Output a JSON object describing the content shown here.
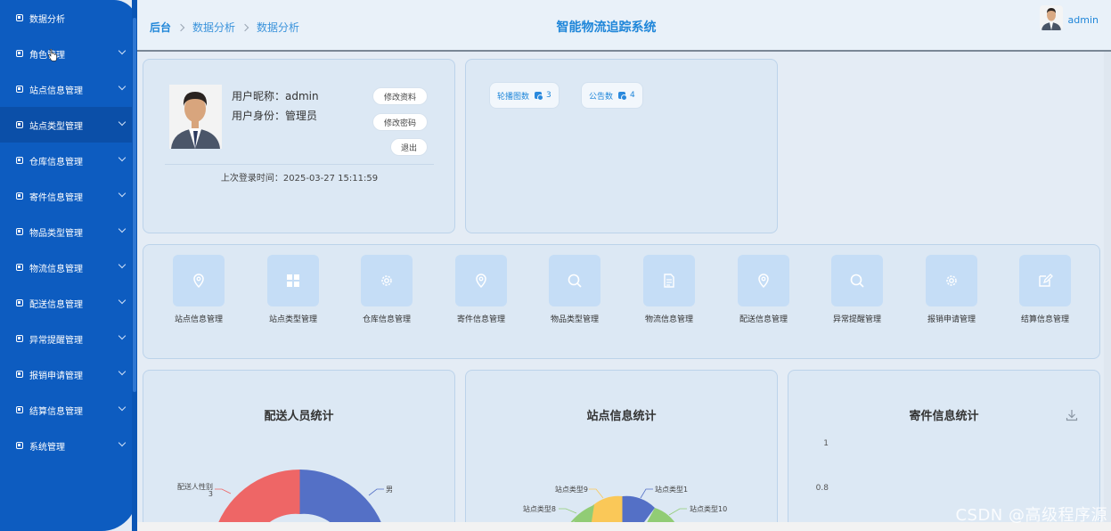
{
  "sidebar": {
    "items": [
      {
        "label": "数据分析"
      },
      {
        "label": "角色管理"
      },
      {
        "label": "站点信息管理"
      },
      {
        "label": "站点类型管理"
      },
      {
        "label": "仓库信息管理"
      },
      {
        "label": "寄件信息管理"
      },
      {
        "label": "物品类型管理"
      },
      {
        "label": "物流信息管理"
      },
      {
        "label": "配送信息管理"
      },
      {
        "label": "异常提醒管理"
      },
      {
        "label": "报销申请管理"
      },
      {
        "label": "结算信息管理"
      },
      {
        "label": "系统管理"
      }
    ]
  },
  "header": {
    "breadcrumb": [
      "后台",
      "数据分析",
      "数据分析"
    ],
    "title": "智能物流追踪系统",
    "user": "admin"
  },
  "profile": {
    "nickname_line": "用户昵称：admin",
    "role_line": "用户身份：管理员",
    "edit_profile": "修改资料",
    "change_password": "修改密码",
    "logout": "退出",
    "last_login": "上次登录时间：2025-03-27 15:11:59"
  },
  "stats": [
    {
      "label": "轮播图数",
      "value": "3"
    },
    {
      "label": "公告数",
      "value": "4"
    }
  ],
  "quick_menu": [
    {
      "label": "站点信息管理",
      "icon": "location-icon"
    },
    {
      "label": "站点类型管理",
      "icon": "grid-icon"
    },
    {
      "label": "仓库信息管理",
      "icon": "gear-icon"
    },
    {
      "label": "寄件信息管理",
      "icon": "location-icon"
    },
    {
      "label": "物品类型管理",
      "icon": "search-icon"
    },
    {
      "label": "物流信息管理",
      "icon": "document-icon"
    },
    {
      "label": "配送信息管理",
      "icon": "location-icon"
    },
    {
      "label": "异常提醒管理",
      "icon": "search-icon"
    },
    {
      "label": "报销申请管理",
      "icon": "gear-icon"
    },
    {
      "label": "结算信息管理",
      "icon": "edit-icon"
    }
  ],
  "colors": {
    "sidebar": "#0d5cc0",
    "accent": "#1f86d9",
    "pie_red": "#ee6666",
    "pie_blue": "#5470c6",
    "pie_green": "#91cc75",
    "pie_yellow": "#fac858"
  },
  "charts": {
    "delivery": {
      "title": "配送人员统计",
      "labels": [
        "配送人性别",
        "3",
        "男"
      ]
    },
    "station": {
      "title": "站点信息统计",
      "labels": [
        "站点类型9",
        "站点类型1",
        "站点类型8",
        "站点类型10"
      ]
    },
    "shipping": {
      "title": "寄件信息统计",
      "ticks": [
        "1",
        "0.8"
      ]
    }
  },
  "watermark": "CSDN @高级程序源"
}
